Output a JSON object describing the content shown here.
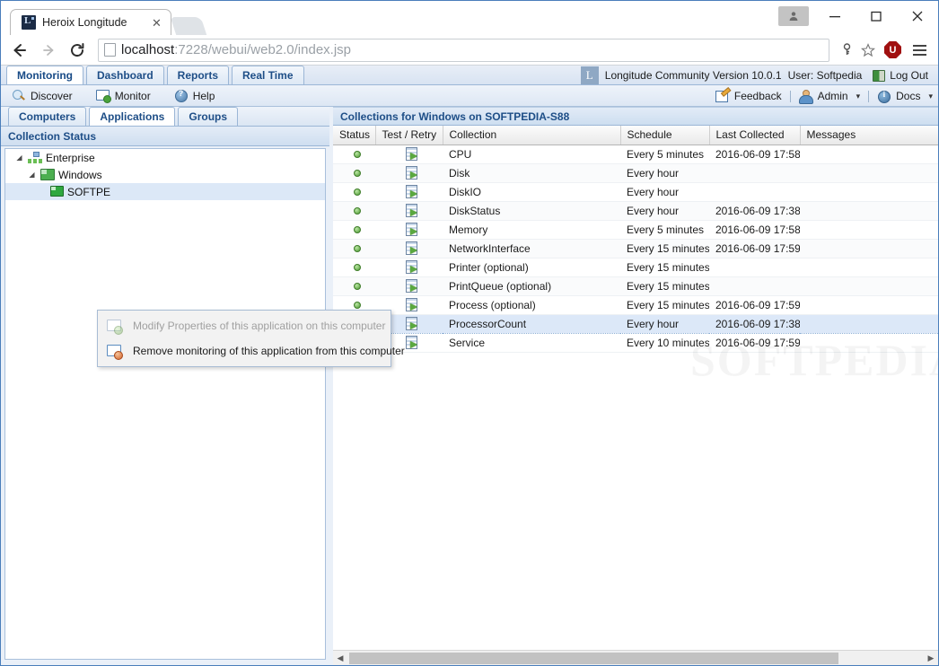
{
  "browser": {
    "tab": {
      "title": "Heroix Longitude",
      "favicon": "longitude-favicon",
      "close_label": "✕"
    },
    "new_tab_label": "",
    "nav": {
      "back": "←",
      "forward": "→",
      "reload": "⟳"
    },
    "url": {
      "host": "localhost",
      "rest": ":7228/webui/web2.0/index.jsp",
      "full": "localhost:7228/webui/web2.0/index.jsp"
    },
    "omni_icons": {
      "key": "🗝",
      "star": "☆",
      "extension": "U"
    },
    "menu": "hamburger-menu",
    "window_controls": {
      "user": "user-account",
      "minimize": "—",
      "maximize": "☐",
      "close": "✕"
    }
  },
  "app": {
    "tabs": [
      {
        "label": "Monitoring",
        "active": true
      },
      {
        "label": "Dashboard",
        "active": false
      },
      {
        "label": "Reports",
        "active": false
      },
      {
        "label": "Real Time",
        "active": false
      }
    ],
    "product_logo": "L",
    "version_text": "Longitude Community Version 10.0.1",
    "user_text": "User: Softpedia",
    "logout_label": "Log Out",
    "actions": [
      {
        "label": "Discover",
        "icon": "search-icon"
      },
      {
        "label": "Monitor",
        "icon": "monitor-icon"
      },
      {
        "label": "Help",
        "icon": "help-icon"
      }
    ],
    "right_actions": [
      {
        "label": "Feedback",
        "icon": "feedback-icon",
        "caret": false
      },
      {
        "label": "Admin",
        "icon": "admin-icon",
        "caret": true
      },
      {
        "label": "Docs",
        "icon": "docs-icon",
        "caret": true
      }
    ],
    "caret_glyph": "▾"
  },
  "left_pane": {
    "tabs": [
      {
        "label": "Computers",
        "active": false
      },
      {
        "label": "Applications",
        "active": true
      },
      {
        "label": "Groups",
        "active": false
      }
    ],
    "title": "Collection Status",
    "tree": [
      {
        "label": "Enterprise",
        "depth": 0,
        "icon": "enterprise-icon",
        "twisty": "◢",
        "selected": false
      },
      {
        "label": "Windows",
        "depth": 1,
        "icon": "windows-group-icon",
        "twisty": "◢",
        "selected": false
      },
      {
        "label": "SOFTPE",
        "depth": 2,
        "icon": "computer-icon",
        "twisty": "",
        "selected": true
      }
    ]
  },
  "context_menu": {
    "items": [
      {
        "label": "Modify Properties of this application on this computer",
        "icon": "modify-properties-icon",
        "disabled": true
      },
      {
        "label": "Remove monitoring of this application from this computer",
        "icon": "remove-monitoring-icon",
        "disabled": false
      }
    ]
  },
  "right_pane": {
    "title": "Collections for Windows on SOFTPEDIA-S88",
    "columns": [
      "Status",
      "Test / Retry",
      "Collection",
      "Schedule",
      "Last Collected",
      "Messages"
    ],
    "rows": [
      {
        "status": "ok",
        "test": "test-retry-icon",
        "collection": "CPU",
        "schedule": "Every 5 minutes",
        "last_collected": "2016-06-09 17:58",
        "messages": "",
        "selected": false
      },
      {
        "status": "ok",
        "test": "test-retry-icon",
        "collection": "Disk",
        "schedule": "Every hour",
        "last_collected": "",
        "messages": "",
        "selected": false
      },
      {
        "status": "ok",
        "test": "test-retry-icon",
        "collection": "DiskIO",
        "schedule": "Every hour",
        "last_collected": "",
        "messages": "",
        "selected": false
      },
      {
        "status": "ok",
        "test": "test-retry-icon",
        "collection": "DiskStatus",
        "schedule": "Every hour",
        "last_collected": "2016-06-09 17:38",
        "messages": "",
        "selected": false
      },
      {
        "status": "ok",
        "test": "test-retry-icon",
        "collection": "Memory",
        "schedule": "Every 5 minutes",
        "last_collected": "2016-06-09 17:58",
        "messages": "",
        "selected": false
      },
      {
        "status": "ok",
        "test": "test-retry-icon",
        "collection": "NetworkInterface",
        "schedule": "Every 15 minutes",
        "last_collected": "2016-06-09 17:59",
        "messages": "",
        "selected": false
      },
      {
        "status": "ok",
        "test": "test-retry-icon",
        "collection": "Printer (optional)",
        "schedule": "Every 15 minutes",
        "last_collected": "",
        "messages": "",
        "selected": false
      },
      {
        "status": "ok",
        "test": "test-retry-icon",
        "collection": "PrintQueue (optional)",
        "schedule": "Every 15 minutes",
        "last_collected": "",
        "messages": "",
        "selected": false
      },
      {
        "status": "ok",
        "test": "test-retry-icon",
        "collection": "Process (optional)",
        "schedule": "Every 15 minutes",
        "last_collected": "2016-06-09 17:59",
        "messages": "",
        "selected": false
      },
      {
        "status": "ok",
        "test": "test-retry-icon",
        "collection": "ProcessorCount",
        "schedule": "Every hour",
        "last_collected": "2016-06-09 17:38",
        "messages": "",
        "selected": true
      },
      {
        "status": "ok",
        "test": "test-retry-icon",
        "collection": "Service",
        "schedule": "Every 10 minutes",
        "last_collected": "2016-06-09 17:59",
        "messages": "",
        "selected": false
      }
    ],
    "scrollbar": {
      "left_arrow": "◀",
      "right_arrow": "▶"
    }
  },
  "watermark": "SOFTPEDIA"
}
